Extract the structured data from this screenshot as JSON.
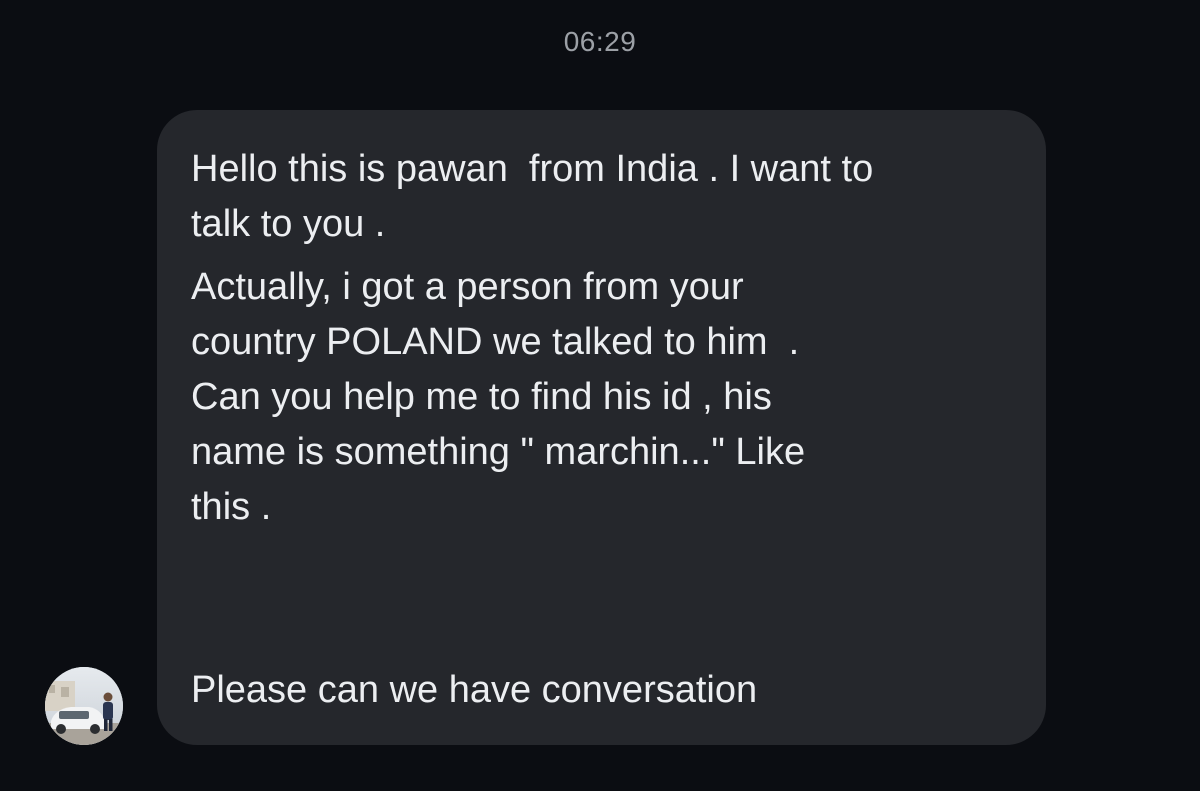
{
  "chat": {
    "timestamp": "06:29",
    "message": {
      "paragraph1": [
        "Hello this is pawan  from India . I want to",
        "talk to you ."
      ],
      "paragraph2": [
        "Actually, i got a person from your",
        "country POLAND we talked to him  .",
        "Can you help me to find his id , his",
        "name is something \" marchin...\" Like",
        "this ."
      ],
      "paragraph3": [
        "Please can we have conversation"
      ]
    },
    "sender": {
      "avatar_icon": "user-avatar-photo"
    }
  }
}
